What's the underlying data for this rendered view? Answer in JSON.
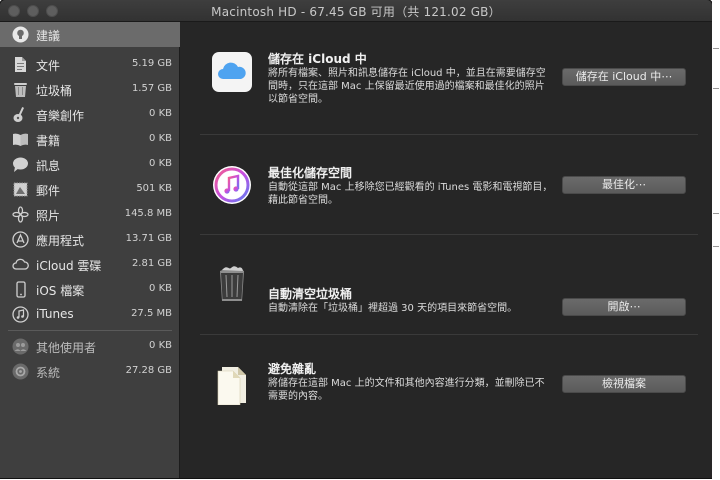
{
  "window": {
    "title": "Macintosh HD - 67.45 GB 可用（共 121.02 GB）"
  },
  "sidebar": {
    "items": [
      {
        "label": "建議",
        "size": "",
        "icon": "lightbulb-icon",
        "selected": true
      },
      {
        "label": "文件",
        "size": "5.19 GB",
        "icon": "document-icon"
      },
      {
        "label": "垃圾桶",
        "size": "1.57 GB",
        "icon": "trash-icon"
      },
      {
        "label": "音樂創作",
        "size": "0 KB",
        "icon": "guitar-icon"
      },
      {
        "label": "書籍",
        "size": "0 KB",
        "icon": "book-icon"
      },
      {
        "label": "訊息",
        "size": "0 KB",
        "icon": "chat-bubble-icon"
      },
      {
        "label": "郵件",
        "size": "501 KB",
        "icon": "stamp-icon"
      },
      {
        "label": "照片",
        "size": "145.8 MB",
        "icon": "photos-flower-icon"
      },
      {
        "label": "應用程式",
        "size": "13.71 GB",
        "icon": "app-store-icon"
      },
      {
        "label": "iCloud 雲碟",
        "size": "2.81 GB",
        "icon": "cloud-icon"
      },
      {
        "label": "iOS 檔案",
        "size": "0 KB",
        "icon": "iphone-icon"
      },
      {
        "label": "iTunes",
        "size": "27.5 MB",
        "icon": "music-note-icon"
      },
      {
        "label": "其他使用者",
        "size": "0 KB",
        "icon": "users-icon"
      },
      {
        "label": "系統",
        "size": "27.28 GB",
        "icon": "system-gear-icon"
      }
    ]
  },
  "recommendations": [
    {
      "title": "儲存在 iCloud 中",
      "description": "將所有檔案、照片和訊息儲存在 iCloud 中，並且在需要儲存空間時，只在這部 Mac 上保留最近使用過的檔案和最佳化的照片以節省空間。",
      "button": "儲存在 iCloud 中⋯",
      "icon": "icloud-icon"
    },
    {
      "title": "最佳化儲存空間",
      "description": "自動從這部 Mac 上移除您已經觀看的 iTunes 電影和電視節目，藉此節省空間。",
      "button": "最佳化⋯",
      "icon": "itunes-icon"
    },
    {
      "title": "自動清空垃圾桶",
      "description": "自動清除在「垃圾桶」裡超過 30 天的項目來節省空間。",
      "button": "開啟⋯",
      "icon": "full-trash-icon"
    },
    {
      "title": "避免雜亂",
      "description": "將儲存在這部 Mac 上的文件和其他內容進行分類，並刪除已不需要的內容。",
      "button": "檢視檔案",
      "icon": "documents-icon"
    }
  ]
}
